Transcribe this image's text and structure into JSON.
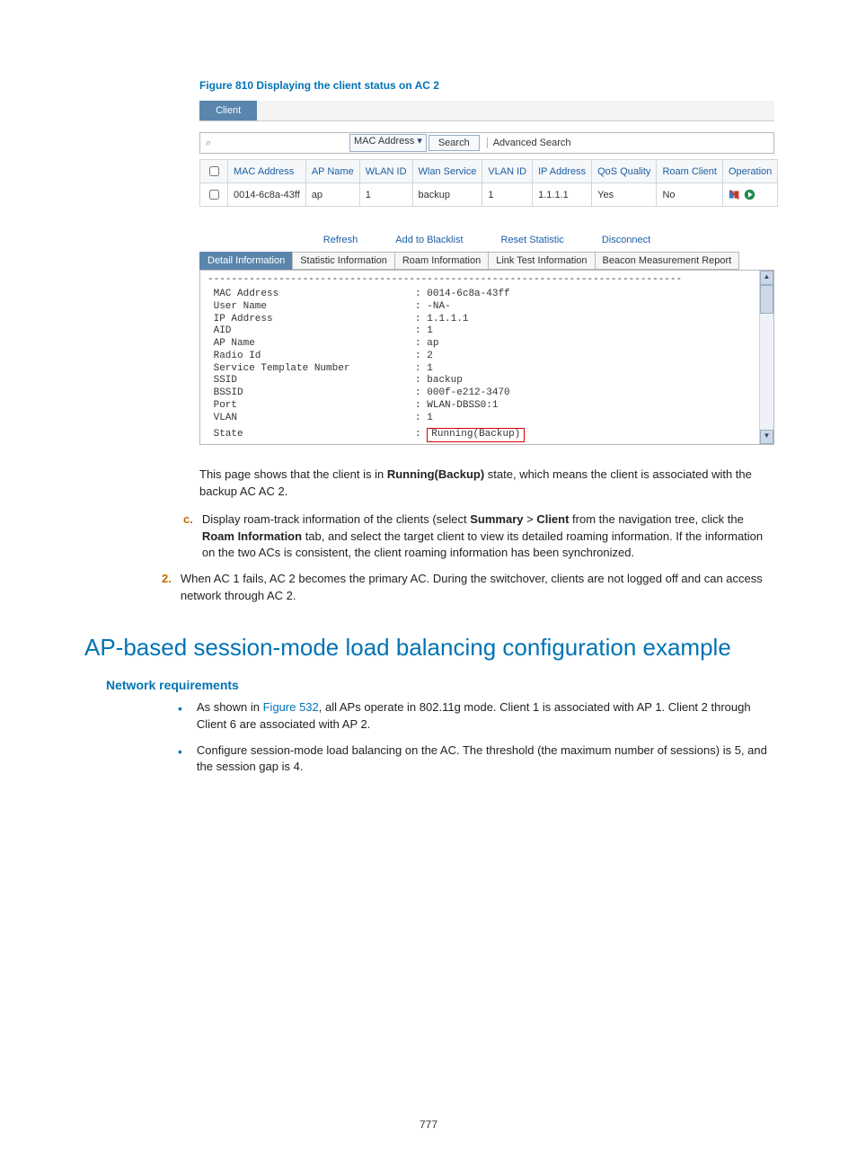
{
  "figure_title": "Figure 810 Displaying the client status on AC 2",
  "tab_label": "Client",
  "search": {
    "select_value": "MAC Address",
    "button": "Search",
    "advanced": "Advanced Search"
  },
  "grid": {
    "headers": [
      "MAC Address",
      "AP Name",
      "WLAN ID",
      "Wlan Service",
      "VLAN ID",
      "IP Address",
      "QoS Quality",
      "Roam Client",
      "Operation"
    ],
    "row": {
      "mac": "0014-6c8a-43ff",
      "ap": "ap",
      "wlanid": "1",
      "service": "backup",
      "vlan": "1",
      "ip": "1.1.1.1",
      "qos": "Yes",
      "roam": "No"
    }
  },
  "actions": [
    "Refresh",
    "Add to Blacklist",
    "Reset Statistic",
    "Disconnect"
  ],
  "subtabs": [
    "Detail Information",
    "Statistic Information",
    "Roam Information",
    "Link Test Information",
    "Beacon Measurement Report"
  ],
  "detail": {
    "rows": [
      [
        "MAC Address",
        "0014-6c8a-43ff"
      ],
      [
        "User Name",
        "-NA-"
      ],
      [
        "IP Address",
        "1.1.1.1"
      ],
      [
        "AID",
        "1"
      ],
      [
        "AP Name",
        "ap"
      ],
      [
        "Radio Id",
        "2"
      ],
      [
        "Service Template Number",
        "1"
      ],
      [
        "SSID",
        "backup"
      ],
      [
        "BSSID",
        "000f-e212-3470"
      ],
      [
        "Port",
        "WLAN-DBSS0:1"
      ],
      [
        "VLAN",
        "1"
      ]
    ],
    "state_label": "State",
    "state_value": "Running(Backup)"
  },
  "para1_a": "This page shows that the client is in ",
  "para1_bold": "Running(Backup)",
  "para1_b": " state, which means the client is associated with the backup AC AC 2.",
  "step_c": {
    "label": "c.",
    "t1": "Display roam-track information of the clients (select ",
    "b1": "Summary",
    "t2": " > ",
    "b2": "Client",
    "t3": " from the navigation tree, click the ",
    "b3": "Roam Information",
    "t4": " tab, and select the target client to view its detailed roaming information. If the information on the two ACs is consistent, the client roaming information has been synchronized."
  },
  "step_2": {
    "label": "2.",
    "text": "When AC 1 fails, AC 2 becomes the primary AC. During the switchover, clients are not logged off and can access network through AC 2."
  },
  "h1": "AP-based session-mode load balancing configuration example",
  "h2": "Network requirements",
  "bullet1_a": "As shown in ",
  "bullet1_link": "Figure 532",
  "bullet1_b": ", all APs operate in 802.11g mode. Client 1 is associated with AP 1. Client 2 through Client 6 are associated with AP 2.",
  "bullet2": "Configure session-mode load balancing on the AC. The threshold (the maximum number of sessions) is 5, and the session gap is 4.",
  "page_number": "777"
}
